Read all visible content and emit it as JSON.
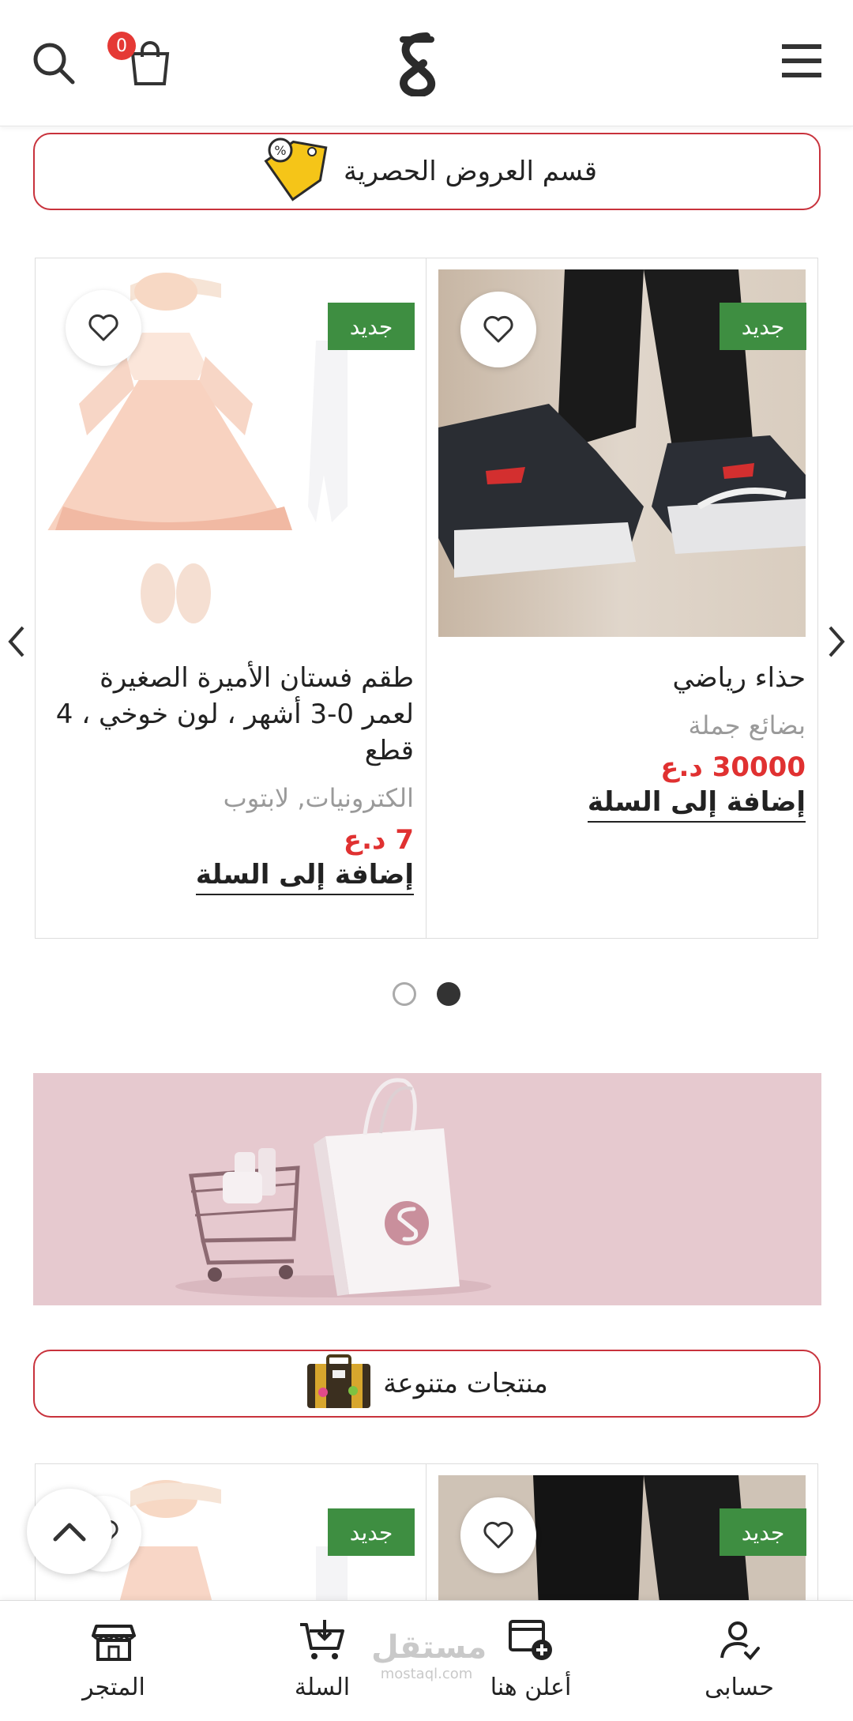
{
  "header": {
    "cart_count": "0"
  },
  "sections": {
    "exclusive_offers": "قسم العروض الحصرية",
    "various_products": "منتجات متنوعة"
  },
  "carousel": {
    "products": [
      {
        "badge": "جديد",
        "name": "حذاء رياضي",
        "category": "بضائع جملة",
        "price": "30000 د.ع",
        "add_to_cart": "إضافة إلى السلة"
      },
      {
        "badge": "جديد",
        "name": "طقم فستان الأميرة الصغيرة لعمر 0-3 أشهر ، لون خوخي ، 4 قطع",
        "category": "الكترونيات, لابتوب",
        "price": "7 د.ع",
        "add_to_cart": "إضافة إلى السلة"
      }
    ],
    "pagination": {
      "total": 2,
      "active": 2
    }
  },
  "second_row": {
    "badges": [
      "جديد",
      "جديد"
    ]
  },
  "bottom_nav": {
    "items": [
      {
        "label": "حسابى",
        "icon": "user-check-icon"
      },
      {
        "label": "أعلن هنا",
        "icon": "add-listing-icon"
      },
      {
        "label": "السلة",
        "icon": "cart-download-icon"
      },
      {
        "label": "المتجر",
        "icon": "store-icon"
      }
    ],
    "watermark": {
      "line1": "مستقل",
      "line2": "mostaql.com"
    }
  },
  "colors": {
    "accent_red": "#c8323c",
    "price_red": "#e03131",
    "badge_green": "#3e8e41",
    "promo_pink": "#e6c9cf"
  }
}
